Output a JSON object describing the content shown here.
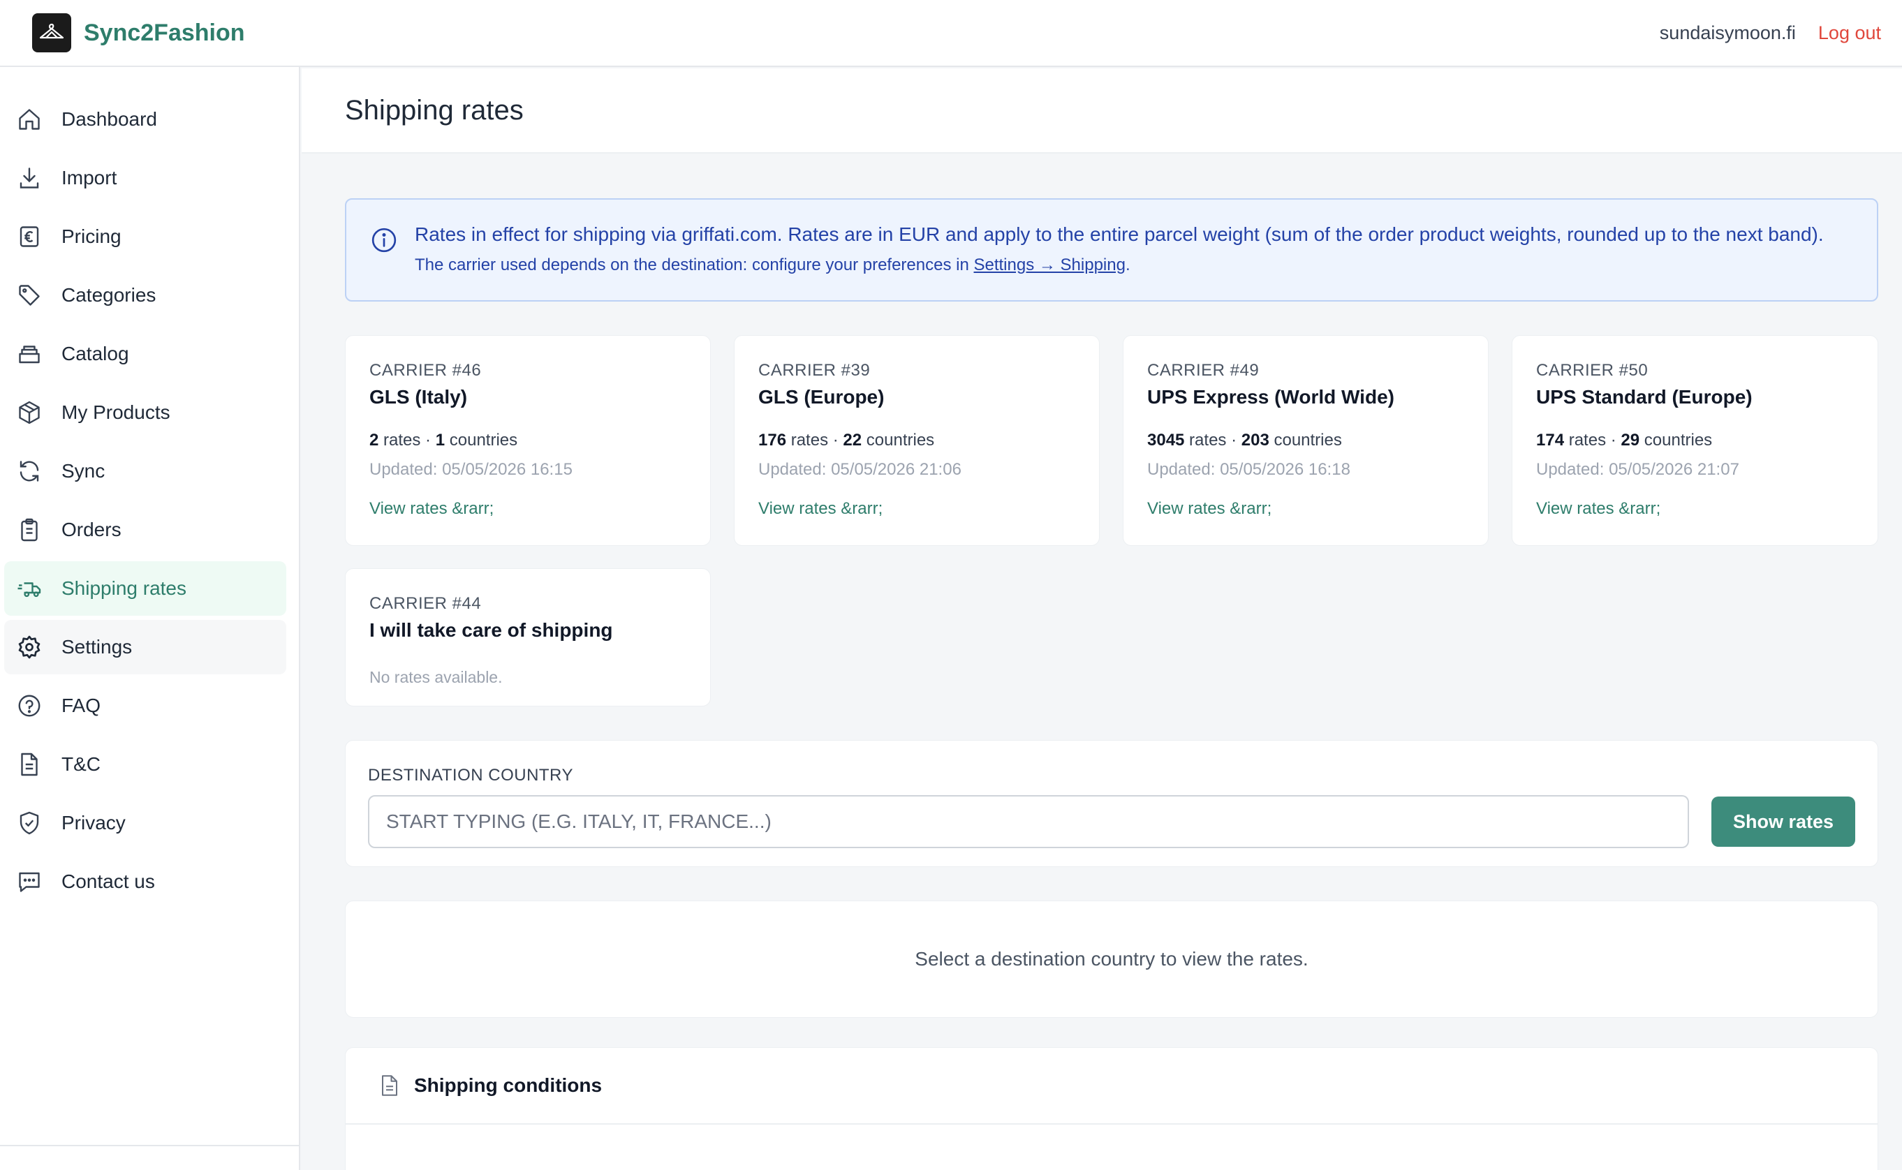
{
  "header": {
    "brand": "Sync2Fashion",
    "user": "sundaisymoon.fi",
    "logout": "Log out"
  },
  "sidebar": {
    "items": [
      {
        "label": "Dashboard",
        "icon": "home-icon"
      },
      {
        "label": "Import",
        "icon": "download-icon"
      },
      {
        "label": "Pricing",
        "icon": "euro-icon"
      },
      {
        "label": "Categories",
        "icon": "tag-icon"
      },
      {
        "label": "Catalog",
        "icon": "catalog-icon"
      },
      {
        "label": "My Products",
        "icon": "box-icon"
      },
      {
        "label": "Sync",
        "icon": "sync-icon"
      },
      {
        "label": "Orders",
        "icon": "clipboard-icon"
      },
      {
        "label": "Shipping rates",
        "icon": "truck-icon"
      },
      {
        "label": "Settings",
        "icon": "gear-icon"
      },
      {
        "label": "FAQ",
        "icon": "help-icon"
      },
      {
        "label": "T&C",
        "icon": "document-icon"
      },
      {
        "label": "Privacy",
        "icon": "shield-icon"
      },
      {
        "label": "Contact us",
        "icon": "chat-icon"
      }
    ]
  },
  "page": {
    "title": "Shipping rates"
  },
  "info": {
    "line1": "Rates in effect for shipping via griffati.com. Rates are in EUR and apply to the entire parcel weight (sum of the order product weights, rounded up to the next band).",
    "line2_prefix": "The carrier used depends on the destination: configure your preferences in ",
    "line2_link": "Settings → Shipping",
    "line2_suffix": "."
  },
  "carriers": [
    {
      "label": "CARRIER #46",
      "name": "GLS (Italy)",
      "rates": "2",
      "rates_unit": " rates · ",
      "countries": "1",
      "countries_unit": " countries",
      "updated": "Updated: 05/05/2026 16:15",
      "link": "View rates &rarr;"
    },
    {
      "label": "CARRIER #39",
      "name": "GLS (Europe)",
      "rates": "176",
      "rates_unit": " rates · ",
      "countries": "22",
      "countries_unit": " countries",
      "updated": "Updated: 05/05/2026 21:06",
      "link": "View rates &rarr;"
    },
    {
      "label": "CARRIER #49",
      "name": "UPS Express (World Wide)",
      "rates": "3045",
      "rates_unit": " rates · ",
      "countries": "203",
      "countries_unit": " countries",
      "updated": "Updated: 05/05/2026 16:18",
      "link": "View rates &rarr;"
    },
    {
      "label": "CARRIER #50",
      "name": "UPS Standard (Europe)",
      "rates": "174",
      "rates_unit": " rates · ",
      "countries": "29",
      "countries_unit": " countries",
      "updated": "Updated: 05/05/2026 21:07",
      "link": "View rates &rarr;"
    },
    {
      "label": "CARRIER #44",
      "name": "I will take care of shipping",
      "empty": "No rates available."
    }
  ],
  "destination": {
    "label": "DESTINATION COUNTRY",
    "placeholder": "START TYPING (E.G. ITALY, IT, FRANCE...)",
    "button": "Show rates"
  },
  "rates_panel": {
    "message": "Select a destination country to view the rates."
  },
  "conditions": {
    "title": "Shipping conditions"
  },
  "colors": {
    "accent": "#2e7d6b",
    "button": "#3d8c7c",
    "logout": "#e0473c",
    "info_bg": "#eef4fe"
  }
}
